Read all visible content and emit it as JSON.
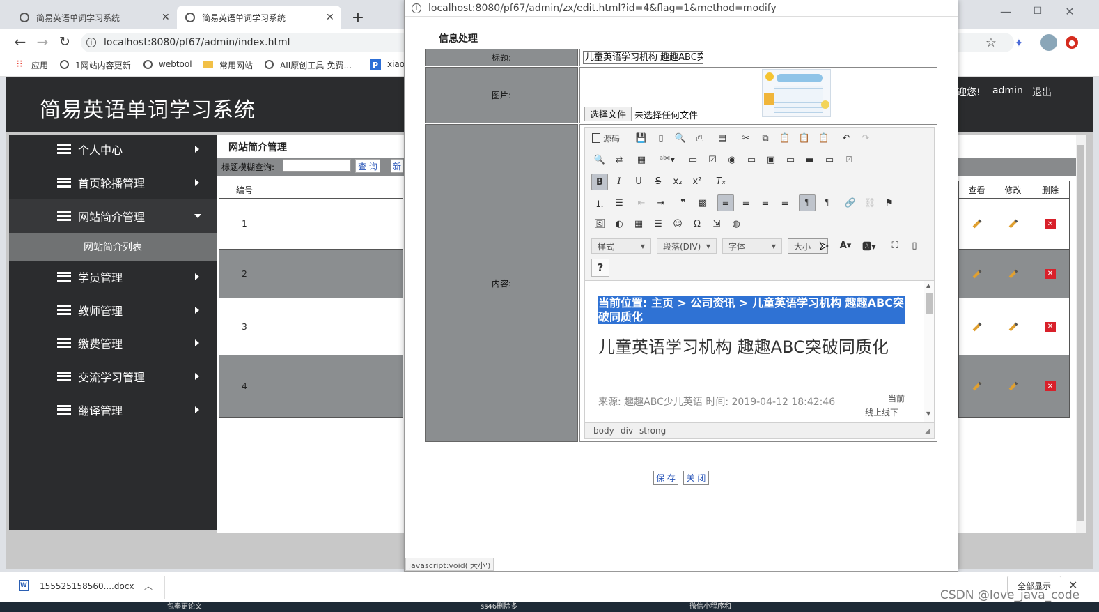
{
  "browser": {
    "tab1_title": "简易英语单词学习系统",
    "tab2_title": "简易英语单词学习系统",
    "address": "localhost:8080/pf67/admin/index.html",
    "bookmarks": [
      "应用",
      "1网站内容更新",
      "webtool",
      "常用网站",
      "AII原创工具-免费...",
      "xiao"
    ]
  },
  "app": {
    "title": "简易英语单词学习系统",
    "welcome": "迎您!",
    "user": "admin",
    "logout": "退出"
  },
  "sidebar": {
    "items": [
      {
        "label": "个人中心"
      },
      {
        "label": "首页轮播管理"
      },
      {
        "label": "网站简介管理"
      },
      {
        "label": "学员管理"
      },
      {
        "label": "教师管理"
      },
      {
        "label": "缴费管理"
      },
      {
        "label": "交流学习管理"
      },
      {
        "label": "翻译管理"
      }
    ],
    "sub_item": "网站简介列表"
  },
  "content": {
    "heading": "网站简介管理",
    "search_label": "标题模糊查询:",
    "search_button": "查 询",
    "new_button": "新",
    "col_id": "编号",
    "col_view": "查看",
    "col_edit": "修改",
    "col_delete": "删除",
    "rows": [
      "1",
      "2",
      "3",
      "4"
    ]
  },
  "popup": {
    "url": "localhost:8080/pf67/admin/zx/edit.html?id=4&flag=1&method=modify",
    "section_title": "信息处理",
    "label_title": "标题:",
    "title_value": "儿童英语学习机构 趣趣ABC突",
    "label_image": "图片:",
    "choose_file": "选择文件",
    "no_file": "未选择任何文件",
    "label_content": "内容:",
    "source_label": "源码",
    "combo_style": "样式",
    "combo_format": "段落(DIV)",
    "combo_font": "字体",
    "combo_size": "大小",
    "help": "?",
    "editor_breadcrumb": "当前位置: 主页 > 公司资讯 > 儿童英语学习机构 趣趣ABC突破同质化",
    "editor_heading": "儿童英语学习机构 趣趣ABC突破同质化",
    "editor_meta": "来源: 趣趣ABC少儿英语 时间: 2019-04-12 18:42:46",
    "editor_side_top": "当前",
    "editor_side_bottom": "线上线下",
    "path_body": "body",
    "path_div": "div",
    "path_strong": "strong",
    "save_button": "保 存",
    "close_button": "关 闭",
    "status": "javascript:void('大小')"
  },
  "downloads": {
    "file": "155525158560....docx",
    "show_all": "全部显示"
  },
  "watermark": "CSDN @love_java_code",
  "taskbar": [
    "包奉更论文",
    "ss46删除多",
    "微信小程序和"
  ]
}
